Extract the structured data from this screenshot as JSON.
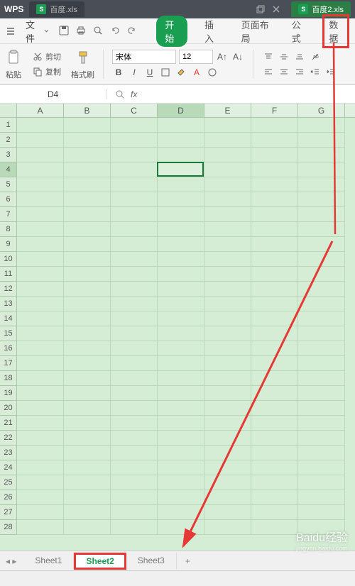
{
  "title_bar": {
    "app_name": "WPS",
    "tabs": [
      {
        "label": "百度.xls",
        "active": false
      },
      {
        "label": "百度2.xls",
        "active": true
      }
    ]
  },
  "menu": {
    "file_label": "文件",
    "tabs": {
      "start": "开始",
      "insert": "插入",
      "page_layout": "页面布局",
      "formula": "公式",
      "data": "数据"
    }
  },
  "ribbon": {
    "cut": "剪切",
    "copy": "复制",
    "paste": "粘贴",
    "format_painter": "格式刷",
    "font_name": "宋体",
    "font_size": "12"
  },
  "name_box": {
    "value": "D4"
  },
  "columns": [
    "A",
    "B",
    "C",
    "D",
    "E",
    "F",
    "G"
  ],
  "row_count": 28,
  "selected": {
    "col": "D",
    "row": 4,
    "col_index": 3
  },
  "sheet_tabs": {
    "items": [
      "Sheet1",
      "Sheet2",
      "Sheet3"
    ],
    "active": "Sheet2",
    "add": "+"
  },
  "watermark": {
    "brand": "Baidu经验",
    "sub": "jingyan.baidu.com"
  }
}
